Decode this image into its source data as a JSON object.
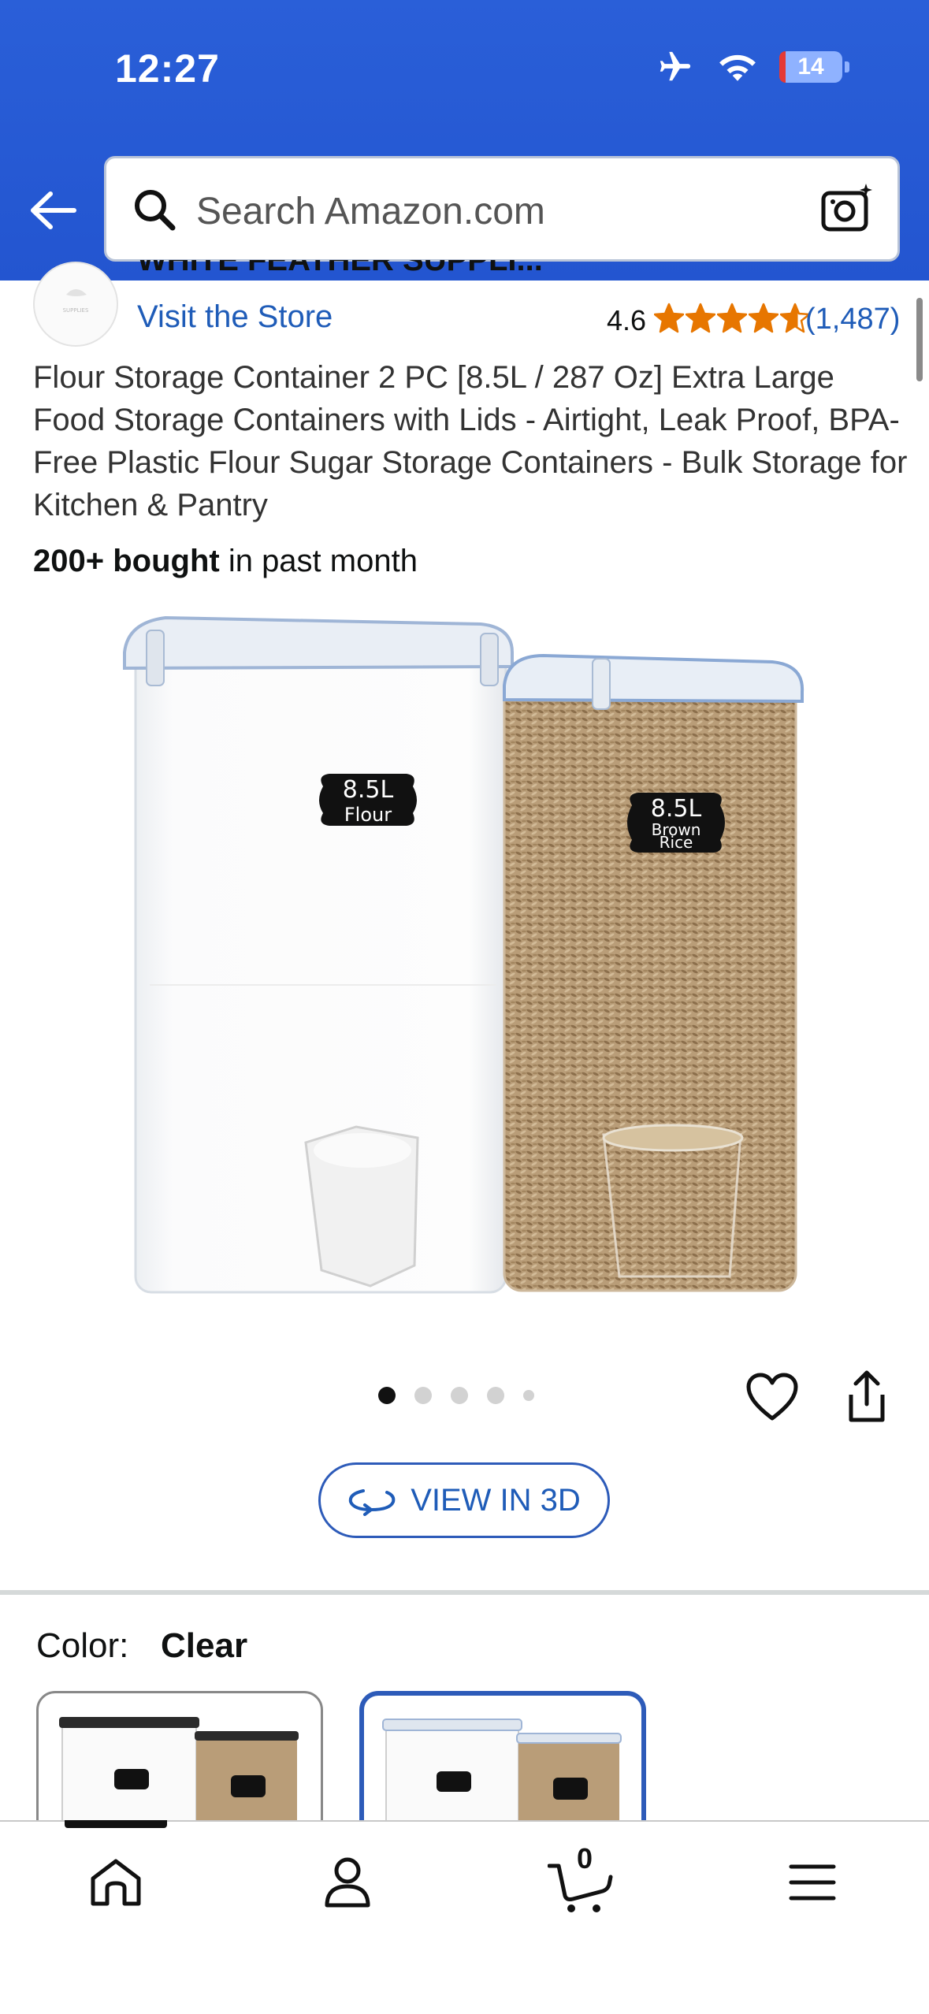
{
  "status_bar": {
    "time": "12:27",
    "battery": "14"
  },
  "search": {
    "placeholder": "Search Amazon.com"
  },
  "store": {
    "name": "WHITE FEATHER SUPPLI...",
    "visit_label": "Visit the Store",
    "rating": "4.6",
    "rating_count": "(1,487)",
    "stars": 4.6
  },
  "product": {
    "title": "Flour Storage Container 2 PC [8.5L / 287 Oz] Extra Large Food Storage Containers with Lids - Airtight, Leak Proof, BPA-Free Plastic Flour Sugar Storage Containers - Bulk Storage for Kitchen & Pantry",
    "bought_bold": "200+ bought",
    "bought_rest": " in past month",
    "label_left_size": "8.5L",
    "label_left_name": "Flour",
    "label_right_size": "8.5L",
    "label_right_name_1": "Brown",
    "label_right_name_2": "Rice",
    "image_count": 5,
    "active_image": 1
  },
  "view_3d_label": "VIEW IN 3D",
  "color": {
    "label": "Color:",
    "value": "Clear"
  },
  "swatches": [
    {
      "name": "black-lid",
      "selected": false
    },
    {
      "name": "clear",
      "selected": true
    }
  ],
  "bottom_nav": {
    "cart_count": "0"
  },
  "colors": {
    "header": "#2355d0",
    "link": "#1f5cb8",
    "star": "#e77600",
    "selected_border": "#2d5bb9"
  }
}
